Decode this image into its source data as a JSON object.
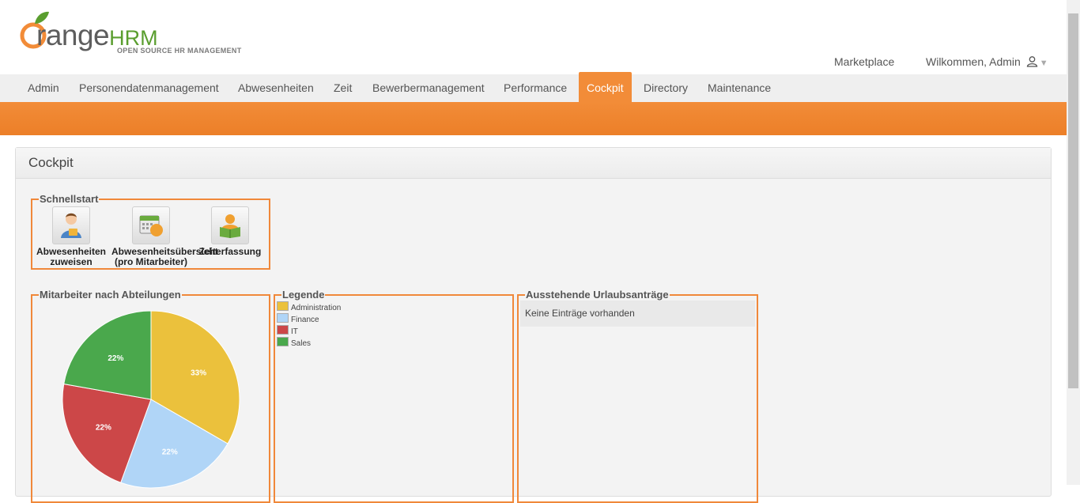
{
  "brand": {
    "name_main": "range",
    "name_hrm": "HRM",
    "tagline": "OPEN SOURCE HR MANAGEMENT"
  },
  "header": {
    "marketplace": "Marketplace",
    "welcome": "Wilkommen, Admin"
  },
  "menu": [
    {
      "label": "Admin"
    },
    {
      "label": "Personendatenmanagement"
    },
    {
      "label": "Abwesenheiten"
    },
    {
      "label": "Zeit"
    },
    {
      "label": "Bewerbermanagement"
    },
    {
      "label": "Performance"
    },
    {
      "label": "Cockpit",
      "active": true
    },
    {
      "label": "Directory"
    },
    {
      "label": "Maintenance"
    }
  ],
  "panel": {
    "title": "Cockpit"
  },
  "quickstart": {
    "title": "Schnellstart",
    "items": [
      {
        "line1": "Abwesenheiten",
        "line2": "zuweisen",
        "icon": "assign-leave-icon"
      },
      {
        "line1": "Abwesenheitsübersicht",
        "line2": "(pro Mitarbeiter)",
        "icon": "leave-calendar-icon"
      },
      {
        "line1": "Zeiterfassung",
        "line2": "",
        "icon": "timesheet-icon"
      }
    ]
  },
  "employees_chart": {
    "title": "Mitarbeiter nach Abteilungen"
  },
  "legend": {
    "title": "Legende",
    "items": [
      {
        "label": "Administration",
        "color": "#ebc13c"
      },
      {
        "label": "Finance",
        "color": "#b0d5f7"
      },
      {
        "label": "IT",
        "color": "#cc4748"
      },
      {
        "label": "Sales",
        "color": "#4aa84c"
      }
    ]
  },
  "pending": {
    "title": "Ausstehende Urlaubsanträge",
    "empty": "Keine Einträge vorhanden"
  },
  "chart_data": {
    "type": "pie",
    "categories": [
      "Administration",
      "Finance",
      "IT",
      "Sales"
    ],
    "values": [
      33,
      22,
      22,
      22
    ],
    "labels": [
      "33%",
      "22%",
      "22%",
      "22%"
    ],
    "colors": [
      "#ebc13c",
      "#b0d5f7",
      "#cc4748",
      "#4aa84c"
    ]
  },
  "colors": {
    "accent": "#f28c38",
    "brand_green": "#5a9e2f"
  }
}
